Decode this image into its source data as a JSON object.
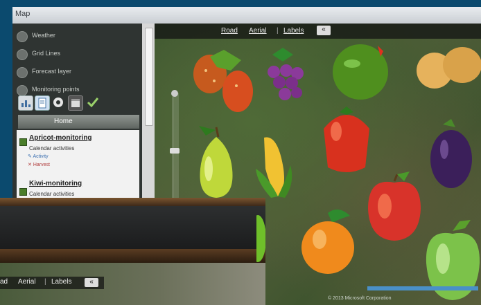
{
  "window": {
    "title": "Map"
  },
  "map_toolbar": {
    "road": "Road",
    "aerial": "Aerial",
    "labels": "Labels",
    "sep": "|",
    "collapse": "«"
  },
  "layers": [
    {
      "label": "Weather"
    },
    {
      "label": "Grid Lines"
    },
    {
      "label": "Forecast layer"
    },
    {
      "label": "Monitoring points"
    }
  ],
  "tabs": {
    "home": "Home"
  },
  "projects": [
    {
      "title": "Apricot-monitoring",
      "subtitle": "Calendar activities",
      "items": [
        "Activity",
        "Harvest"
      ]
    },
    {
      "title": "Kiwi-monitoring",
      "subtitle": "Calendar activities"
    }
  ],
  "second_panel_toolbar": {
    "road": "ad",
    "aerial": "Aerial",
    "labels": "Labels",
    "sep": "|",
    "collapse": "«"
  },
  "credits": "© 2013 Microsoft Corporation",
  "colors": {
    "accent": "#4a7d2a",
    "background": "#0b4a6e",
    "scalebar": "#4a90c8"
  },
  "fruit_markers": [
    "strawberry",
    "grapes",
    "lime",
    "potato",
    "tomato",
    "plum",
    "pear",
    "corn",
    "apple",
    "peach",
    "apricot",
    "green-apple",
    "green-pepper"
  ]
}
